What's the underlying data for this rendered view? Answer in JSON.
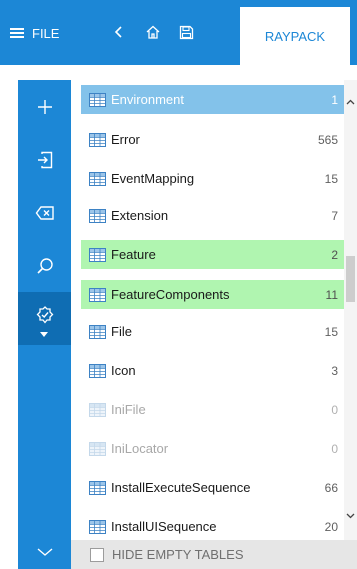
{
  "header": {
    "menu_label": "FILE",
    "tab_label": "RAYPACK",
    "accent_color": "#1c87d6",
    "icons": [
      "hamburger-icon",
      "back-icon",
      "home-icon",
      "save-icon"
    ]
  },
  "sidebar": {
    "buttons": [
      {
        "icon": "plus-icon"
      },
      {
        "icon": "import-icon"
      },
      {
        "icon": "backspace-icon"
      },
      {
        "icon": "search-icon"
      },
      {
        "icon": "validate-icon"
      },
      {
        "icon": "chevron-down-icon"
      }
    ]
  },
  "tables": [
    {
      "name": "Environment",
      "count": "1",
      "state": "selected"
    },
    {
      "name": "Error",
      "count": "565",
      "state": "normal"
    },
    {
      "name": "EventMapping",
      "count": "15",
      "state": "normal"
    },
    {
      "name": "Extension",
      "count": "7",
      "state": "normal"
    },
    {
      "name": "Feature",
      "count": "2",
      "state": "modified"
    },
    {
      "name": "FeatureComponents",
      "count": "11",
      "state": "modified"
    },
    {
      "name": "File",
      "count": "15",
      "state": "normal"
    },
    {
      "name": "Icon",
      "count": "3",
      "state": "normal"
    },
    {
      "name": "IniFile",
      "count": "0",
      "state": "empty"
    },
    {
      "name": "IniLocator",
      "count": "0",
      "state": "empty"
    },
    {
      "name": "InstallExecuteSequence",
      "count": "66",
      "state": "normal"
    },
    {
      "name": "InstallUISequence",
      "count": "20",
      "state": "normal"
    }
  ],
  "footer": {
    "hide_empty_label": "HIDE EMPTY TABLES",
    "hide_empty_checked": false
  },
  "colors": {
    "selected_row": "#83c2ea",
    "modified_row": "#b0f5b0"
  }
}
